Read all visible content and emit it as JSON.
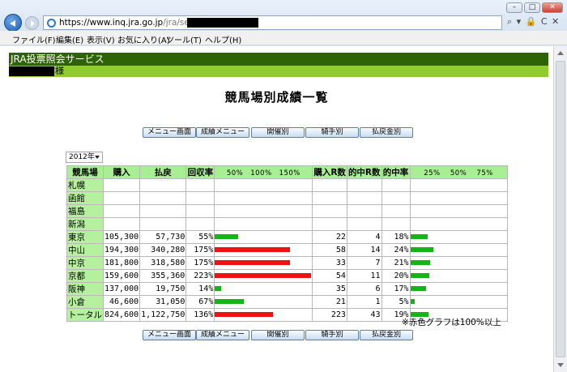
{
  "browser": {
    "url_scheme": "https://",
    "url_host": "www.inq.jra.go.jp",
    "url_path": "/jra/servlet/JRAW",
    "addr_controls": "⌕ ▾ 🔒 C ✕",
    "minimize": "–",
    "maximize": "□",
    "close": "✕",
    "menu": [
      "ファイル(F)",
      "編集(E)",
      "表示(V)",
      "お気に入り(A)",
      "ツール(T)",
      "ヘルプ(H)"
    ]
  },
  "page": {
    "service_title": "JRA投票照会サービス",
    "user_suffix": "様",
    "title": "競馬場別成績一覧",
    "nav_buttons": [
      "メニュー画面",
      "成績メニュー",
      "開催別",
      "騎手別",
      "払戻金別"
    ],
    "year_selected": "2012年",
    "note": "※赤色グラフは100%以上"
  },
  "table": {
    "headers": {
      "venue": "競馬場",
      "purchase": "購入",
      "payout": "払戻",
      "return_rate": "回収率",
      "return_scale": "50%　100%　150%",
      "bought_r": "購入R数",
      "hit_r": "的中R数",
      "hit_rate": "的中率",
      "hit_scale": "25%　 50%　 75%"
    },
    "colors": {
      "over100": "#ee1111",
      "under100": "#16b416"
    },
    "rows": [
      {
        "venue": "札幌",
        "purchase": "",
        "payout": "",
        "rate": "",
        "rate_value": 0,
        "races": "",
        "hits": "",
        "hit_rate": "",
        "hit_value": 0
      },
      {
        "venue": "函館",
        "purchase": "",
        "payout": "",
        "rate": "",
        "rate_value": 0,
        "races": "",
        "hits": "",
        "hit_rate": "",
        "hit_value": 0
      },
      {
        "venue": "福島",
        "purchase": "",
        "payout": "",
        "rate": "",
        "rate_value": 0,
        "races": "",
        "hits": "",
        "hit_rate": "",
        "hit_value": 0
      },
      {
        "venue": "新潟",
        "purchase": "",
        "payout": "",
        "rate": "",
        "rate_value": 0,
        "races": "",
        "hits": "",
        "hit_rate": "",
        "hit_value": 0
      },
      {
        "venue": "東京",
        "purchase": "105,300",
        "payout": "57,730",
        "rate": "55%",
        "rate_value": 55,
        "races": "22",
        "hits": "4",
        "hit_rate": "18%",
        "hit_value": 18
      },
      {
        "venue": "中山",
        "purchase": "194,300",
        "payout": "340,280",
        "rate": "175%",
        "rate_value": 175,
        "races": "58",
        "hits": "14",
        "hit_rate": "24%",
        "hit_value": 24
      },
      {
        "venue": "中京",
        "purchase": "181,800",
        "payout": "318,580",
        "rate": "175%",
        "rate_value": 175,
        "races": "33",
        "hits": "7",
        "hit_rate": "21%",
        "hit_value": 21
      },
      {
        "venue": "京都",
        "purchase": "159,600",
        "payout": "355,360",
        "rate": "223%",
        "rate_value": 223,
        "races": "54",
        "hits": "11",
        "hit_rate": "20%",
        "hit_value": 20
      },
      {
        "venue": "阪神",
        "purchase": "137,000",
        "payout": "19,750",
        "rate": "14%",
        "rate_value": 14,
        "races": "35",
        "hits": "6",
        "hit_rate": "17%",
        "hit_value": 17
      },
      {
        "venue": "小倉",
        "purchase": "46,600",
        "payout": "31,050",
        "rate": "67%",
        "rate_value": 67,
        "races": "21",
        "hits": "1",
        "hit_rate": "5%",
        "hit_value": 5
      },
      {
        "venue": "トータル",
        "purchase": "824,600",
        "payout": "1,122,750",
        "rate": "136%",
        "rate_value": 136,
        "races": "223",
        "hits": "43",
        "hit_rate": "19%",
        "hit_value": 19
      }
    ]
  }
}
